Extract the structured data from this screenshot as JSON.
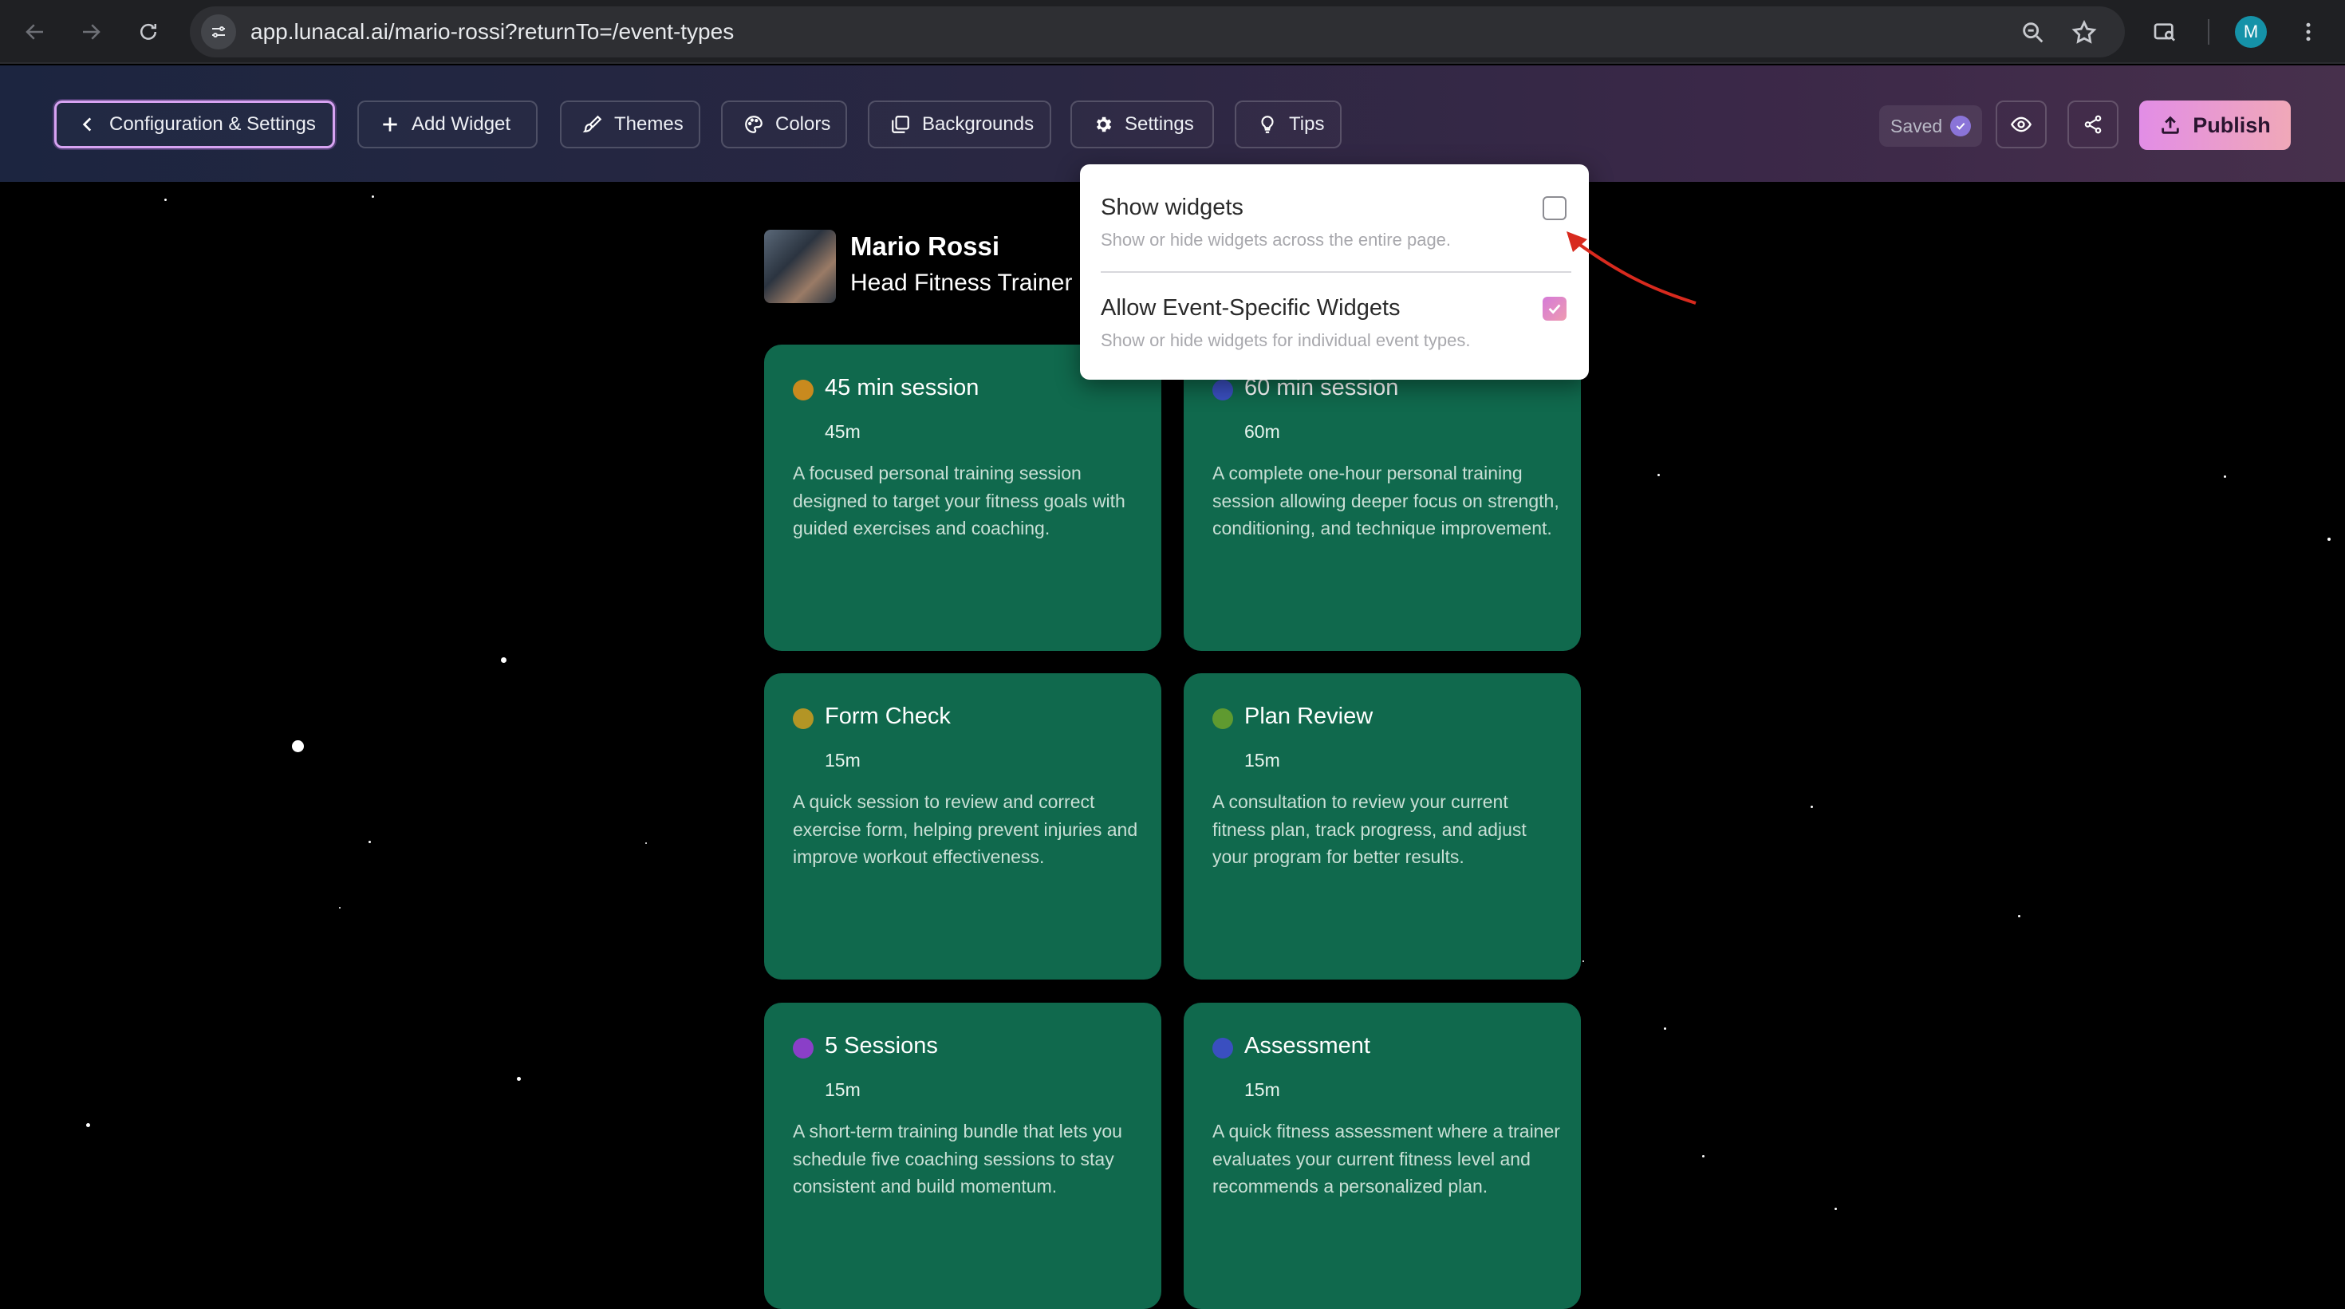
{
  "browser": {
    "url": "app.lunacal.ai/mario-rossi?returnTo=/event-types",
    "profile_initial": "M"
  },
  "toolbar": {
    "config_label": "Configuration & Settings",
    "add_widget_label": "Add Widget",
    "themes_label": "Themes",
    "colors_label": "Colors",
    "backgrounds_label": "Backgrounds",
    "settings_label": "Settings",
    "tips_label": "Tips",
    "saved_label": "Saved",
    "publish_label": "Publish"
  },
  "profile": {
    "name": "Mario Rossi",
    "title": "Head Fitness Trainer"
  },
  "settings_popover": {
    "show_widgets": {
      "label": "Show widgets",
      "description": "Show or hide widgets across the entire page.",
      "checked": false
    },
    "event_specific": {
      "label": "Allow Event-Specific Widgets",
      "description": "Show or hide widgets for individual event types.",
      "checked": true
    }
  },
  "events": [
    {
      "title": "45 min session",
      "duration": "45m",
      "dot_color": "#c98a1e",
      "description": "A focused personal training session designed to target your fitness goals with guided exercises and coaching."
    },
    {
      "title": "60 min session",
      "duration": "60m",
      "dot_color": "#3a4fc0",
      "description": "A complete one-hour personal training session allowing deeper focus on strength, conditioning, and technique improvement."
    },
    {
      "title": "Form Check",
      "duration": "15m",
      "dot_color": "#b39525",
      "description": "A quick session to review and correct exercise form, helping prevent injuries and improve workout effectiveness."
    },
    {
      "title": "Plan Review",
      "duration": "15m",
      "dot_color": "#5f9a30",
      "description": "A consultation to review your current fitness plan, track progress, and adjust your program for better results."
    },
    {
      "title": "5 Sessions",
      "duration": "15m",
      "dot_color": "#8a3fc8",
      "description": "A short-term training bundle that lets you schedule five coaching sessions to stay consistent and build momentum."
    },
    {
      "title": "Assessment",
      "duration": "15m",
      "dot_color": "#3a4fc0",
      "description": "A quick fitness assessment where a trainer evaluates your current fitness level and recommends a personalized plan."
    }
  ],
  "colors": {
    "card_bg": "#10694d",
    "accent_gradient_start": "#e28de6",
    "accent_gradient_end": "#f0a8b8",
    "annotation_arrow": "#d82a1e"
  },
  "icons": {
    "back": "arrow-left-icon",
    "forward": "arrow-right-icon",
    "reload": "reload-icon",
    "site_settings": "tune-icon",
    "zoom": "zoom-icon",
    "bookmark": "star-icon",
    "tab_search": "tab-search-icon",
    "menu": "kebab-menu-icon",
    "config": "chevron-left-icon",
    "add_widget": "plus-icon",
    "themes": "brush-icon",
    "colors": "palette-icon",
    "backgrounds": "layers-icon",
    "settings": "gear-icon",
    "tips": "lightbulb-icon",
    "preview": "eye-icon",
    "share": "share-icon",
    "publish": "upload-icon"
  }
}
